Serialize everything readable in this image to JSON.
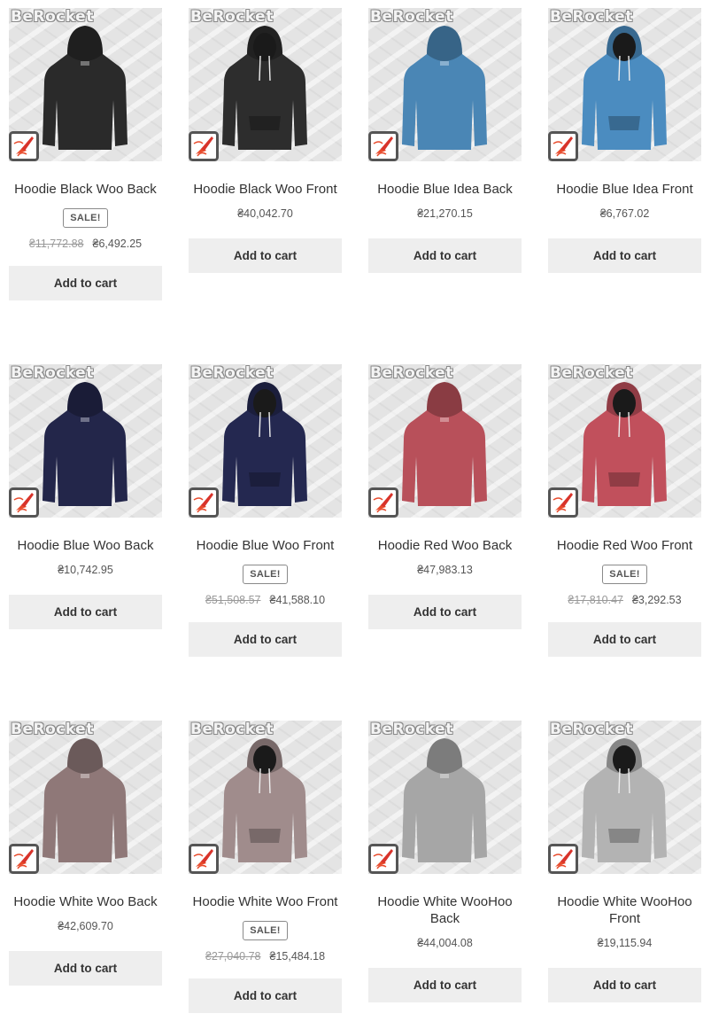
{
  "watermark": "BeRocket",
  "add_to_cart_label": "Add to cart",
  "sale_label": "SALE!",
  "products": [
    {
      "name": "Hoodie Black Woo Back",
      "on_sale": true,
      "old_price": "₴11,772.88",
      "price": "₴6,492.25",
      "color": "#2a2a2a",
      "view": "back"
    },
    {
      "name": "Hoodie Black Woo Front",
      "on_sale": false,
      "old_price": "",
      "price": "₴40,042.70",
      "color": "#2d2d2d",
      "view": "front"
    },
    {
      "name": "Hoodie Blue Idea Back",
      "on_sale": false,
      "old_price": "",
      "price": "₴21,270.15",
      "color": "#4a86b5",
      "view": "back"
    },
    {
      "name": "Hoodie Blue Idea Front",
      "on_sale": false,
      "old_price": "",
      "price": "₴6,767.02",
      "color": "#4b8cc0",
      "view": "front"
    },
    {
      "name": "Hoodie Blue Woo Back",
      "on_sale": false,
      "old_price": "",
      "price": "₴10,742.95",
      "color": "#23264a",
      "view": "back"
    },
    {
      "name": "Hoodie Blue Woo Front",
      "on_sale": true,
      "old_price": "₴51,508.57",
      "price": "₴41,588.10",
      "color": "#242850",
      "view": "front"
    },
    {
      "name": "Hoodie Red Woo Back",
      "on_sale": false,
      "old_price": "",
      "price": "₴47,983.13",
      "color": "#b8505a",
      "view": "back"
    },
    {
      "name": "Hoodie Red Woo Front",
      "on_sale": true,
      "old_price": "₴17,810.47",
      "price": "₴3,292.53",
      "color": "#c1505c",
      "view": "front"
    },
    {
      "name": "Hoodie White Woo Back",
      "on_sale": false,
      "old_price": "",
      "price": "₴42,609.70",
      "color": "#8f7878",
      "view": "back"
    },
    {
      "name": "Hoodie White Woo Front",
      "on_sale": true,
      "old_price": "₴27,040.78",
      "price": "₴15,484.18",
      "color": "#a08c8c",
      "view": "front"
    },
    {
      "name": "Hoodie White WooHoo Back",
      "on_sale": false,
      "old_price": "",
      "price": "₴44,004.08",
      "color": "#a6a6a6",
      "view": "back"
    },
    {
      "name": "Hoodie White WooHoo Front",
      "on_sale": false,
      "old_price": "",
      "price": "₴19,115.94",
      "color": "#b3b3b3",
      "view": "front"
    }
  ]
}
